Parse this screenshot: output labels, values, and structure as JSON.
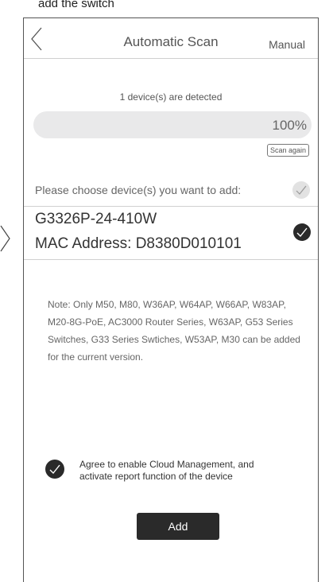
{
  "caption": "add the switch",
  "header": {
    "title": "Automatic Scan",
    "manual_label": "Manual"
  },
  "scan": {
    "detected_text": "1 device(s) are detected",
    "progress_percent": 100,
    "percent_label": "100%",
    "scan_again_label": "Scan again"
  },
  "choose_label": "Please choose device(s) you want to add:",
  "device": {
    "name": "G3326P-24-410W",
    "mac": "MAC Address: D8380D010101",
    "selected": true
  },
  "note": "Note: Only M50, M80, W36AP, W64AP, W66AP, W83AP, M20-8G-PoE, AC3000 Router Series, W63AP, G53 Series Switches, G33 Series Swtiches, W53AP, M30 can be added for the current version.",
  "agree": {
    "checked": true,
    "text": "Agree to enable Cloud Management, and activate report function of the device"
  },
  "add_label": "Add",
  "colors": {
    "dark": "#2a2a2a",
    "track": "#e9e9ea",
    "text": "#555555"
  }
}
